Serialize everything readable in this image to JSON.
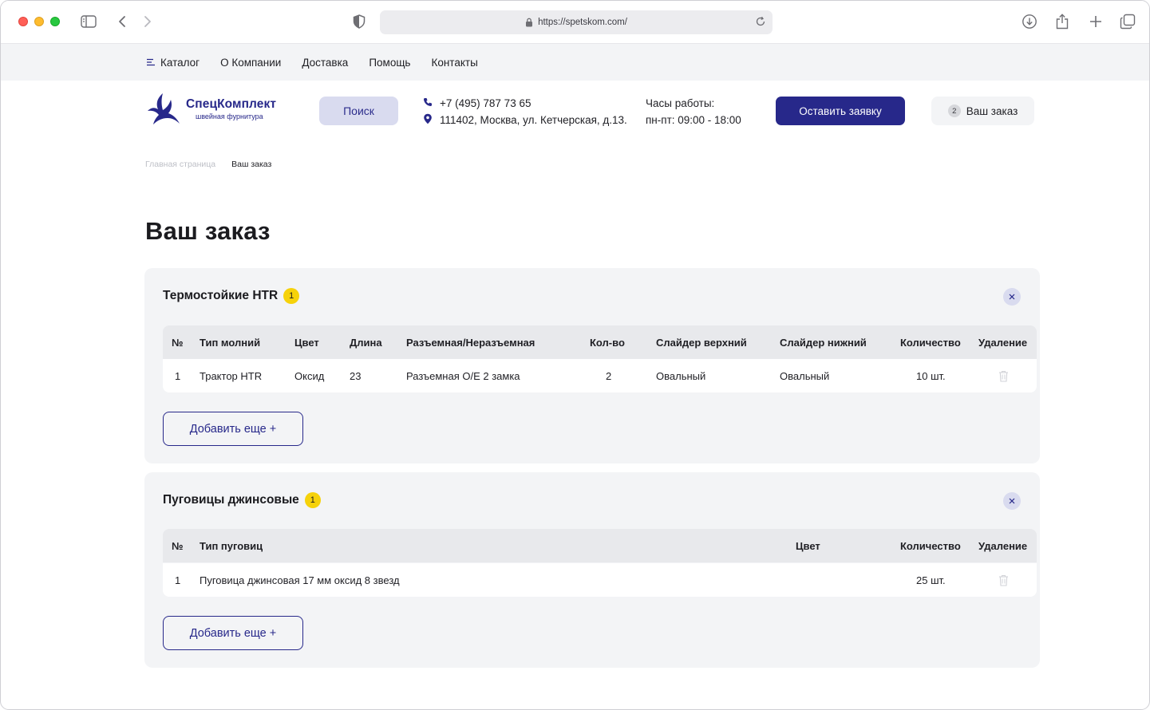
{
  "browser": {
    "url": "https://spetskom.com/"
  },
  "topnav": {
    "items": [
      "Каталог",
      "О Компании",
      "Доставка",
      "Помощь",
      "Контакты"
    ]
  },
  "header": {
    "logo_name": "СпецКомплект",
    "logo_sub": "швейная фурнитура",
    "search_label": "Поиск",
    "phone": "+7 (495) 787 73 65",
    "address": "111402, Москва, ул. Кетчерская, д.13.",
    "hours_label": "Часы работы:",
    "hours_value": "пн-пт: 09:00 - 18:00",
    "cta_label": "Оставить заявку",
    "order_count": "2",
    "order_label": "Ваш заказ"
  },
  "breadcrumb": {
    "home": "Главная страница",
    "current": "Ваш заказ"
  },
  "page": {
    "title": "Ваш заказ"
  },
  "colors": {
    "brand": "#27288a",
    "badge": "#f6d20a",
    "card_bg": "#f3f4f6"
  },
  "sections": [
    {
      "title": "Термостойкие HTR",
      "count": "1",
      "columns": [
        "№",
        "Тип молний",
        "Цвет",
        "Длина",
        "Разъемная/Неразъемная",
        "Кол-во",
        "Слайдер верхний",
        "Слайдер нижний",
        "Количество",
        "Удаление"
      ],
      "rows": [
        [
          "1",
          "Трактор HTR",
          "Оксид",
          "23",
          "Разъемная О/Е 2 замка",
          "2",
          "Овальный",
          "Овальный",
          "10 шт."
        ]
      ],
      "add_label": "Добавить еще +"
    },
    {
      "title": "Пуговицы джинсовые",
      "count": "1",
      "columns": [
        "№",
        "Тип пуговиц",
        "Цвет",
        "Количество",
        "Удаление"
      ],
      "rows": [
        [
          "1",
          "Пуговица джинсовая 17 мм оксид 8 звезд",
          "",
          "25 шт."
        ]
      ],
      "add_label": "Добавить еще +"
    }
  ]
}
